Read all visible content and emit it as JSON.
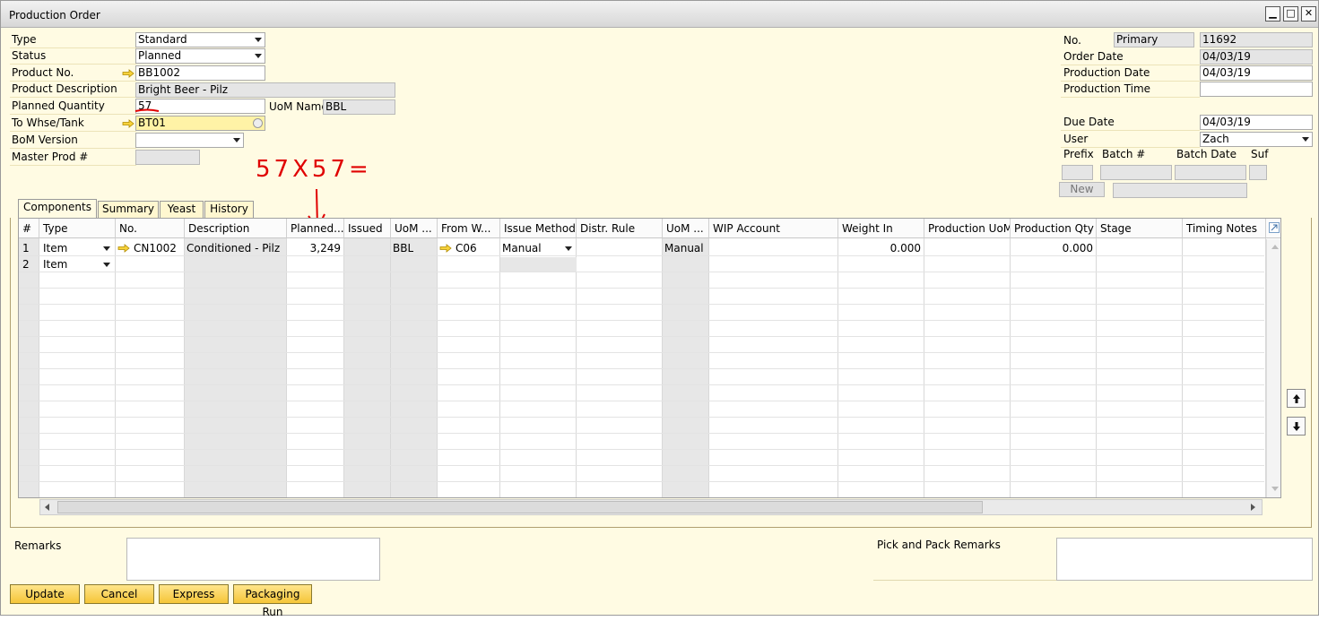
{
  "window": {
    "title": "Production Order"
  },
  "header_left": {
    "type": {
      "label": "Type",
      "value": "Standard"
    },
    "status": {
      "label": "Status",
      "value": "Planned"
    },
    "product_no": {
      "label": "Product No.",
      "value": "BB1002"
    },
    "product_description": {
      "label": "Product Description",
      "value": "Bright Beer - Pilz"
    },
    "planned_quantity": {
      "label": "Planned Quantity",
      "value": "57"
    },
    "uom_name": {
      "label": "UoM Name",
      "value": "BBL"
    },
    "to_whse": {
      "label": "To Whse/Tank",
      "value": "BT01"
    },
    "bom_version": {
      "label": "BoM Version",
      "value": ""
    },
    "master_prod": {
      "label": "Master Prod #",
      "value": ""
    }
  },
  "header_right": {
    "no": {
      "label": "No.",
      "series": "Primary",
      "value": "11692"
    },
    "order_date": {
      "label": "Order Date",
      "value": "04/03/19"
    },
    "production_date": {
      "label": "Production Date",
      "value": "04/03/19"
    },
    "production_time": {
      "label": "Production Time",
      "value": ""
    },
    "due_date": {
      "label": "Due Date",
      "value": "04/03/19"
    },
    "user": {
      "label": "User",
      "value": "Zach"
    },
    "batch": {
      "prefix_label": "Prefix",
      "batch_label": "Batch #",
      "batch_date_label": "Batch Date",
      "suf_label": "Suf",
      "new_button": "New"
    }
  },
  "annotation": {
    "text": "57X57="
  },
  "tabs": [
    "Components",
    "Summary",
    "Yeast",
    "History"
  ],
  "grid": {
    "columns": [
      "#",
      "Type",
      "No.",
      "Description",
      "Planned...",
      "Issued",
      "UoM ...",
      "From W...",
      "Issue Method",
      "Distr. Rule",
      "UoM ...",
      "WIP Account",
      "Weight In",
      "Production UoM",
      "Production Qty",
      "Stage",
      "Timing Notes"
    ],
    "rows": [
      {
        "num": "1",
        "type": "Item",
        "no": "CN1002",
        "description": "Conditioned - Pilz",
        "planned": "3,249",
        "issued": "",
        "uom": "BBL",
        "from_whse": "C06",
        "issue_method": "Manual",
        "distr_rule": "",
        "uom2": "Manual",
        "wip": "",
        "weight_in": "0.000",
        "prod_uom": "",
        "prod_qty": "0.000",
        "stage": "",
        "timing": ""
      },
      {
        "num": "2",
        "type": "Item",
        "no": "",
        "description": "",
        "planned": "",
        "issued": "",
        "uom": "",
        "from_whse": "",
        "issue_method": "",
        "distr_rule": "",
        "uom2": "",
        "wip": "",
        "weight_in": "",
        "prod_uom": "",
        "prod_qty": "",
        "stage": "",
        "timing": ""
      }
    ]
  },
  "remarks": {
    "label": "Remarks",
    "value": ""
  },
  "pick_pack_remarks": {
    "label": "Pick and Pack Remarks",
    "value": ""
  },
  "buttons": {
    "update": "Update",
    "cancel": "Cancel",
    "express": "Express",
    "packaging_run": "Packaging Run"
  }
}
